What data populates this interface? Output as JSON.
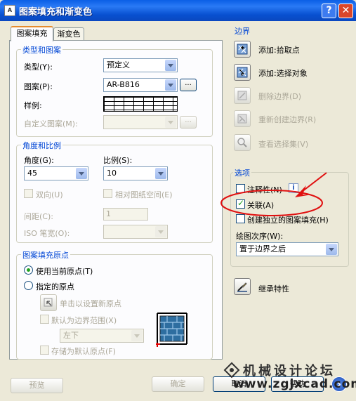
{
  "window": {
    "title": "图案填充和渐变色",
    "help_label": "?",
    "close_label": "✕"
  },
  "tabs": [
    {
      "label": "图案填充"
    },
    {
      "label": "渐变色"
    }
  ],
  "type_pattern": {
    "title": "类型和图案",
    "type_label": "类型(Y):",
    "type_value": "预定义",
    "pattern_label": "图案(P):",
    "pattern_value": "AR-B816",
    "pattern_browse": "...",
    "swatch_label": "样例:",
    "custom_label": "自定义图案(M):",
    "custom_value": "",
    "custom_browse": "..."
  },
  "angle_scale": {
    "title": "角度和比例",
    "angle_label": "角度(G):",
    "angle_value": "45",
    "scale_label": "比例(S):",
    "scale_value": "10",
    "double_label": "双向(U)",
    "relative_label": "相对图纸空间(E)",
    "spacing_label": "间距(C):",
    "spacing_value": "1",
    "iso_label": "ISO 笔宽(O):",
    "iso_value": ""
  },
  "origin": {
    "title": "图案填充原点",
    "use_current": "使用当前原点(T)",
    "specified": "指定的原点",
    "click_set": "单击以设置新原点",
    "default_extents": "默认为边界范围(X)",
    "position_value": "左下",
    "store_default": "存储为默认原点(F)"
  },
  "boundaries": {
    "title": "边界",
    "add_pick": "添加:拾取点",
    "add_select": "添加:选择对象",
    "remove": "删除边界(D)",
    "recreate": "重新创建边界(R)",
    "view": "查看选择集(V)"
  },
  "options": {
    "title": "选项",
    "annotative": "注释性(N)",
    "annotative_info": "i",
    "associative": "关联(A)",
    "associative_checked": true,
    "separate": "创建独立的图案填充(H)",
    "draw_order_label": "绘图次序(W):",
    "draw_order_value": "置于边界之后"
  },
  "inherit": {
    "label": "继承特性"
  },
  "footer": {
    "preview": "预览",
    "ok": "确定",
    "cancel": "取消",
    "help": "帮助",
    "more": "›"
  },
  "watermark": {
    "name": "机械设计论坛",
    "url": "www.zgjxcad.com"
  },
  "colors": {
    "annotation_red": "#e01010",
    "group_title": "#0046d5",
    "titlebar": "#0a5fe6"
  }
}
